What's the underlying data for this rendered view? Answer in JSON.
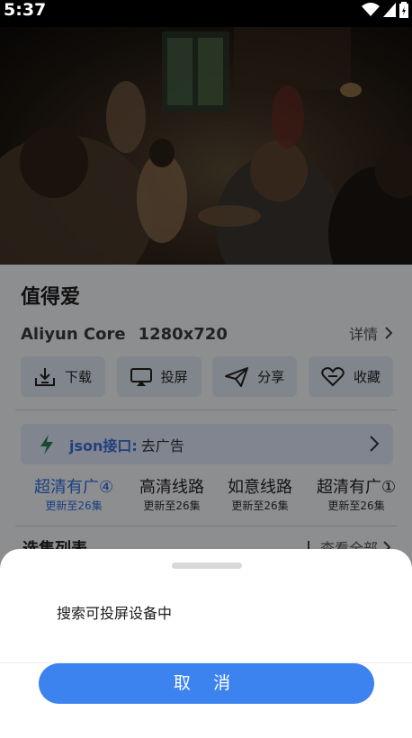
{
  "status_bar": {
    "time": "5:37"
  },
  "video": {
    "description_icon": "video-still"
  },
  "movie": {
    "title": "值得爱",
    "source": "Aliyun Core",
    "resolution": "1280x720",
    "detail_label": "详情"
  },
  "actions": [
    {
      "label": "下载",
      "icon": "download-icon"
    },
    {
      "label": "投屏",
      "icon": "cast-icon"
    },
    {
      "label": "分享",
      "icon": "share-icon"
    },
    {
      "label": "收藏",
      "icon": "heart-icon"
    }
  ],
  "json_interface": {
    "label": "json接口:",
    "value": "去广告"
  },
  "routes": [
    {
      "name": "超清有广④",
      "sub": "更新至26集",
      "active": true
    },
    {
      "name": "高清线路",
      "sub": "更新至26集",
      "active": false
    },
    {
      "name": "如意线路",
      "sub": "更新至26集",
      "active": false
    },
    {
      "name": "超清有广①",
      "sub": "更新至26集",
      "active": false
    }
  ],
  "episodes": {
    "title": "选集列表",
    "view_all": "查看全部"
  },
  "cast_sheet": {
    "message": "搜索可投屏设备中",
    "cancel_label": "取 消"
  },
  "colors": {
    "accent": "#3d83f0",
    "active_route": "#2f6ee0"
  }
}
